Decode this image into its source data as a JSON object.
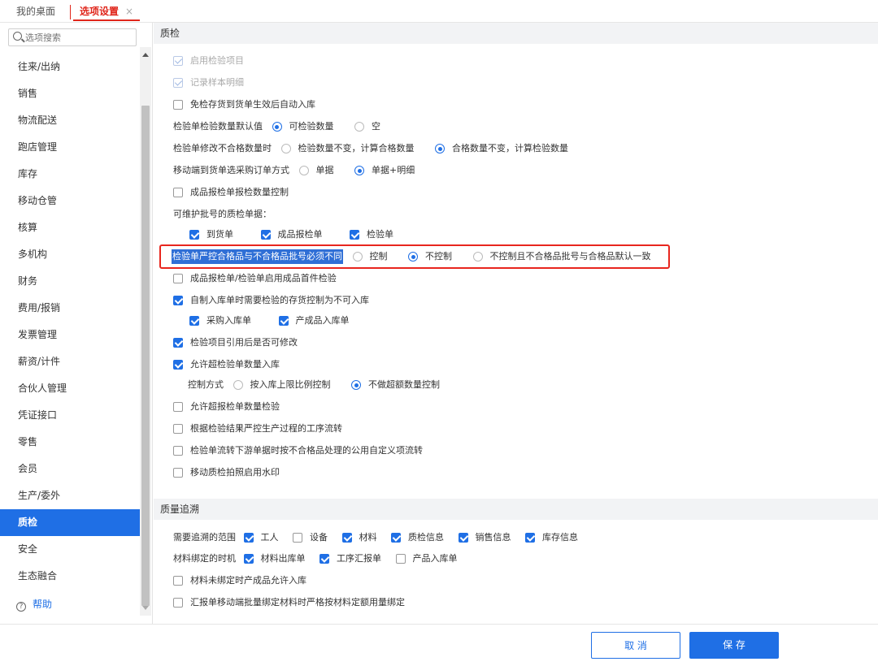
{
  "tabs": [
    {
      "label": "我的桌面"
    },
    {
      "label": "选项设置",
      "close": "×"
    }
  ],
  "sidebar": {
    "search_placeholder": "选项搜索",
    "items": [
      "往来/出纳",
      "销售",
      "物流配送",
      "跑店管理",
      "库存",
      "移动仓管",
      "核算",
      "多机构",
      "财务",
      "费用/报销",
      "发票管理",
      "薪资/计件",
      "合伙人管理",
      "凭证接口",
      "零售",
      "会员",
      "生产/委外",
      "质检",
      "安全",
      "生态融合"
    ],
    "active": "质检",
    "help": "帮助"
  },
  "quality": {
    "title": "质检",
    "enable_items": "启用检验项目",
    "record_sample": "记录样本明细",
    "auto_stock": "免检存货到货单生效后自动入库",
    "default_qty_label": "检验单检验数量默认值",
    "default_qty_opt1": "可检验数量",
    "default_qty_opt2": "空",
    "modify_label": "检验单修改不合格数量时",
    "modify_opt1": "检验数量不变，计算合格数量",
    "modify_opt2": "合格数量不变，计算检验数量",
    "mobile_label": "移动端到货单选采购订单方式",
    "mobile_opt1": "单据",
    "mobile_opt2": "单据+明细",
    "product_report_ctrl": "成品报检单报检数量控制",
    "batch_label": "可维护批号的质检单据：",
    "batch_opt1": "到货单",
    "batch_opt2": "成品报检单",
    "batch_opt3": "检验单",
    "strict_label": "检验单严控合格品与不合格品批号必须不同",
    "strict_opt1": "控制",
    "strict_opt2": "不控制",
    "strict_opt3": "不控制且不合格品批号与合格品默认一致",
    "first_check": "成品报检单/检验单启用成品首件检验",
    "self_made": "自制入库单时需要检验的存货控制为不可入库",
    "purchase_in": "采购入库单",
    "product_in": "产成品入库单",
    "item_modify": "检验项目引用后是否可修改",
    "allow_over": "允许超检验单数量入库",
    "ctrl_label": "控制方式",
    "ctrl_opt1": "按入库上限比例控制",
    "ctrl_opt2": "不做超额数量控制",
    "allow_over_report": "允许超报检单数量检验",
    "strict_flow": "根据检验结果严控生产过程的工序流转",
    "downstream": "检验单流转下游单据时按不合格品处理的公用自定义项流转",
    "watermark": "移动质检拍照启用水印"
  },
  "trace": {
    "title": "质量追溯",
    "scope_label": "需要追溯的范围",
    "scope": [
      "工人",
      "设备",
      "材料",
      "质检信息",
      "销售信息",
      "库存信息"
    ],
    "bind_label": "材料绑定的时机",
    "bind": [
      "材料出库单",
      "工序汇报单",
      "产品入库单"
    ],
    "unbound": "材料未绑定时产成品允许入库",
    "strict_bind": "汇报单移动端批量绑定材料时严格按材料定额用量绑定"
  },
  "footer": {
    "cancel": "取 消",
    "save": "保 存"
  }
}
